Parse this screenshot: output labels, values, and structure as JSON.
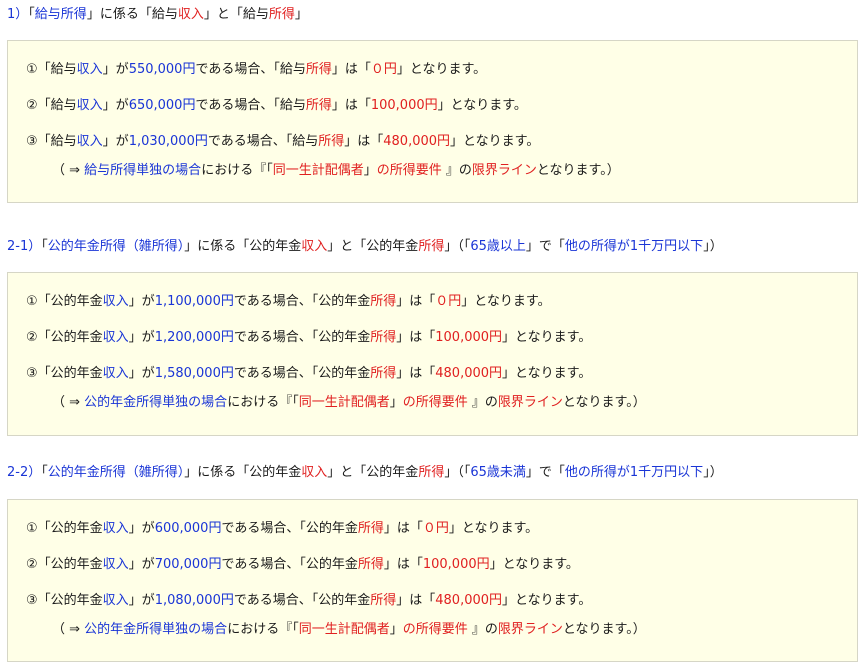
{
  "sections": [
    {
      "heading": [
        {
          "t": "1）",
          "c": "b"
        },
        {
          "t": "「",
          "c": ""
        },
        {
          "t": "給与所得",
          "c": "b"
        },
        {
          "t": "」に係る「給与",
          "c": ""
        },
        {
          "t": "収入",
          "c": "r"
        },
        {
          "t": "」と「給与",
          "c": ""
        },
        {
          "t": "所得",
          "c": "r"
        },
        {
          "t": "」",
          "c": ""
        }
      ],
      "lines": [
        [
          {
            "t": "①「給与",
            "c": ""
          },
          {
            "t": "収入",
            "c": "b"
          },
          {
            "t": "」が",
            "c": ""
          },
          {
            "t": "550,000円",
            "c": "b"
          },
          {
            "t": "である場合、「給与",
            "c": ""
          },
          {
            "t": "所得",
            "c": "r"
          },
          {
            "t": "」は「",
            "c": ""
          },
          {
            "t": "０円",
            "c": "r"
          },
          {
            "t": "」となります。",
            "c": ""
          }
        ],
        [
          {
            "t": "②「給与",
            "c": ""
          },
          {
            "t": "収入",
            "c": "b"
          },
          {
            "t": "」が",
            "c": ""
          },
          {
            "t": "650,000円",
            "c": "b"
          },
          {
            "t": "である場合、「給与",
            "c": ""
          },
          {
            "t": "所得",
            "c": "r"
          },
          {
            "t": "」は「",
            "c": ""
          },
          {
            "t": "100,000円",
            "c": "r"
          },
          {
            "t": "」となります。",
            "c": ""
          }
        ],
        [
          {
            "t": "③「給与",
            "c": ""
          },
          {
            "t": "収入",
            "c": "b"
          },
          {
            "t": "」が",
            "c": ""
          },
          {
            "t": "1,030,000円",
            "c": "b"
          },
          {
            "t": "である場合、「給与",
            "c": ""
          },
          {
            "t": "所得",
            "c": "r"
          },
          {
            "t": "」は「",
            "c": ""
          },
          {
            "t": "480,000円",
            "c": "r"
          },
          {
            "t": "」となります。",
            "c": ""
          }
        ]
      ],
      "note": [
        {
          "t": "（ ⇒ ",
          "c": ""
        },
        {
          "t": "給与所得単独の場合",
          "c": "b"
        },
        {
          "t": "における『「",
          "c": ""
        },
        {
          "t": "同一生計配偶者",
          "c": "r"
        },
        {
          "t": "」",
          "c": ""
        },
        {
          "t": "の所得要件",
          "c": "r"
        },
        {
          "t": " 』の",
          "c": ""
        },
        {
          "t": "限界ライン",
          "c": "r"
        },
        {
          "t": "となります。）",
          "c": ""
        }
      ]
    },
    {
      "heading": [
        {
          "t": "2-1）",
          "c": "b"
        },
        {
          "t": "「",
          "c": ""
        },
        {
          "t": "公的年金所得（雑所得）",
          "c": "b"
        },
        {
          "t": "」に係る「公的年金",
          "c": ""
        },
        {
          "t": "収入",
          "c": "r"
        },
        {
          "t": "」と「公的年金",
          "c": ""
        },
        {
          "t": "所得",
          "c": "r"
        },
        {
          "t": "」（「",
          "c": ""
        },
        {
          "t": "65歳以上",
          "c": "b"
        },
        {
          "t": "」で「",
          "c": ""
        },
        {
          "t": "他の所得が1千万円以下",
          "c": "b"
        },
        {
          "t": "」）",
          "c": ""
        }
      ],
      "lines": [
        [
          {
            "t": "①「公的年金",
            "c": ""
          },
          {
            "t": "収入",
            "c": "b"
          },
          {
            "t": "」が",
            "c": ""
          },
          {
            "t": "1,100,000円",
            "c": "b"
          },
          {
            "t": "である場合、「公的年金",
            "c": ""
          },
          {
            "t": "所得",
            "c": "r"
          },
          {
            "t": "」は「",
            "c": ""
          },
          {
            "t": "０円",
            "c": "r"
          },
          {
            "t": "」となります。",
            "c": ""
          }
        ],
        [
          {
            "t": "②「公的年金",
            "c": ""
          },
          {
            "t": "収入",
            "c": "b"
          },
          {
            "t": "」が",
            "c": ""
          },
          {
            "t": "1,200,000円",
            "c": "b"
          },
          {
            "t": "である場合、「公的年金",
            "c": ""
          },
          {
            "t": "所得",
            "c": "r"
          },
          {
            "t": "」は「",
            "c": ""
          },
          {
            "t": "100,000円",
            "c": "r"
          },
          {
            "t": "」となります。",
            "c": ""
          }
        ],
        [
          {
            "t": "③「公的年金",
            "c": ""
          },
          {
            "t": "収入",
            "c": "b"
          },
          {
            "t": "」が",
            "c": ""
          },
          {
            "t": "1,580,000円",
            "c": "b"
          },
          {
            "t": "である場合、「公的年金",
            "c": ""
          },
          {
            "t": "所得",
            "c": "r"
          },
          {
            "t": "」は「",
            "c": ""
          },
          {
            "t": "480,000円",
            "c": "r"
          },
          {
            "t": "」となります。",
            "c": ""
          }
        ]
      ],
      "note": [
        {
          "t": "（ ⇒ ",
          "c": ""
        },
        {
          "t": "公的年金所得単独の場合",
          "c": "b"
        },
        {
          "t": "における『「",
          "c": ""
        },
        {
          "t": "同一生計配偶者",
          "c": "r"
        },
        {
          "t": "」",
          "c": ""
        },
        {
          "t": "の所得要件",
          "c": "r"
        },
        {
          "t": " 』の",
          "c": ""
        },
        {
          "t": "限界ライン",
          "c": "r"
        },
        {
          "t": "となります。）",
          "c": ""
        }
      ]
    },
    {
      "heading": [
        {
          "t": "2-2）",
          "c": "b"
        },
        {
          "t": "「",
          "c": ""
        },
        {
          "t": "公的年金所得（雑所得）",
          "c": "b"
        },
        {
          "t": "」に係る「公的年金",
          "c": ""
        },
        {
          "t": "収入",
          "c": "r"
        },
        {
          "t": "」と「公的年金",
          "c": ""
        },
        {
          "t": "所得",
          "c": "r"
        },
        {
          "t": "」（「",
          "c": ""
        },
        {
          "t": "65歳未満",
          "c": "b"
        },
        {
          "t": "」で「",
          "c": ""
        },
        {
          "t": "他の所得が1千万円以下",
          "c": "b"
        },
        {
          "t": "」）",
          "c": ""
        }
      ],
      "lines": [
        [
          {
            "t": "①「公的年金",
            "c": ""
          },
          {
            "t": "収入",
            "c": "b"
          },
          {
            "t": "」が",
            "c": ""
          },
          {
            "t": "600,000円",
            "c": "b"
          },
          {
            "t": "である場合、「公的年金",
            "c": ""
          },
          {
            "t": "所得",
            "c": "r"
          },
          {
            "t": "」は「",
            "c": ""
          },
          {
            "t": "０円",
            "c": "r"
          },
          {
            "t": "」となります。",
            "c": ""
          }
        ],
        [
          {
            "t": "②「公的年金",
            "c": ""
          },
          {
            "t": "収入",
            "c": "b"
          },
          {
            "t": "」が",
            "c": ""
          },
          {
            "t": "700,000円",
            "c": "b"
          },
          {
            "t": "である場合、「公的年金",
            "c": ""
          },
          {
            "t": "所得",
            "c": "r"
          },
          {
            "t": "」は「",
            "c": ""
          },
          {
            "t": "100,000円",
            "c": "r"
          },
          {
            "t": "」となります。",
            "c": ""
          }
        ],
        [
          {
            "t": "③「公的年金",
            "c": ""
          },
          {
            "t": "収入",
            "c": "b"
          },
          {
            "t": "」が",
            "c": ""
          },
          {
            "t": "1,080,000円",
            "c": "b"
          },
          {
            "t": "である場合、「公的年金",
            "c": ""
          },
          {
            "t": "所得",
            "c": "r"
          },
          {
            "t": "」は「",
            "c": ""
          },
          {
            "t": "480,000円",
            "c": "r"
          },
          {
            "t": "」となります。",
            "c": ""
          }
        ]
      ],
      "note": [
        {
          "t": "（ ⇒ ",
          "c": ""
        },
        {
          "t": "公的年金所得単独の場合",
          "c": "b"
        },
        {
          "t": "における『「",
          "c": ""
        },
        {
          "t": "同一生計配偶者",
          "c": "r"
        },
        {
          "t": "」",
          "c": ""
        },
        {
          "t": "の所得要件",
          "c": "r"
        },
        {
          "t": " 』の",
          "c": ""
        },
        {
          "t": "限界ライン",
          "c": "r"
        },
        {
          "t": "となります。）",
          "c": ""
        }
      ]
    }
  ]
}
